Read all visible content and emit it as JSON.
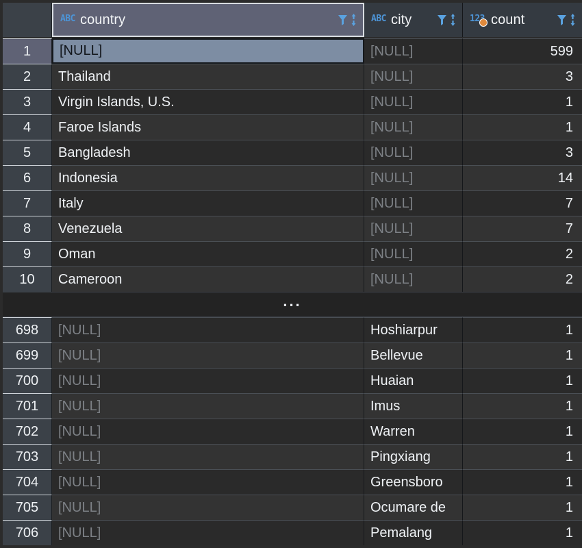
{
  "grid": {
    "columns": [
      {
        "key": "country",
        "label": "country",
        "type_icon": "abc-type-icon",
        "type": "text",
        "active": true
      },
      {
        "key": "city",
        "label": "city",
        "type_icon": "abc-type-icon",
        "type": "text",
        "active": false
      },
      {
        "key": "count",
        "label": "count",
        "type_icon": "123-type-icon",
        "type": "number",
        "active": false
      }
    ],
    "header_icons": {
      "filter": "filter-icon",
      "sort": "sort-ascending-descending-icon"
    },
    "null_text": "[NULL]",
    "ellipsis": "...",
    "selected_cell": {
      "row": "1",
      "column": "country"
    },
    "colors": {
      "header_bg": "#343a41",
      "header_active_bg": "#5f6275",
      "row_num_bg": "#3b4148",
      "row_odd_bg": "#2a2a2a",
      "row_even_bg": "#333333",
      "selection_bg": "#7d8da3",
      "text": "#eef1f4",
      "null_text": "#7d8186",
      "type_icon_blue": "#4d94d6",
      "number_badge_orange": "#e08a3c"
    },
    "rows_top": [
      {
        "num": "1",
        "country": "[NULL]",
        "country_null": false,
        "city": "[NULL]",
        "city_null": true,
        "count": "599"
      },
      {
        "num": "2",
        "country": "Thailand",
        "country_null": false,
        "city": "[NULL]",
        "city_null": true,
        "count": "3"
      },
      {
        "num": "3",
        "country": "Virgin Islands, U.S.",
        "country_null": false,
        "city": "[NULL]",
        "city_null": true,
        "count": "1"
      },
      {
        "num": "4",
        "country": "Faroe Islands",
        "country_null": false,
        "city": "[NULL]",
        "city_null": true,
        "count": "1"
      },
      {
        "num": "5",
        "country": "Bangladesh",
        "country_null": false,
        "city": "[NULL]",
        "city_null": true,
        "count": "3"
      },
      {
        "num": "6",
        "country": "Indonesia",
        "country_null": false,
        "city": "[NULL]",
        "city_null": true,
        "count": "14"
      },
      {
        "num": "7",
        "country": "Italy",
        "country_null": false,
        "city": "[NULL]",
        "city_null": true,
        "count": "7"
      },
      {
        "num": "8",
        "country": "Venezuela",
        "country_null": false,
        "city": "[NULL]",
        "city_null": true,
        "count": "7"
      },
      {
        "num": "9",
        "country": "Oman",
        "country_null": false,
        "city": "[NULL]",
        "city_null": true,
        "count": "2"
      },
      {
        "num": "10",
        "country": "Cameroon",
        "country_null": false,
        "city": "[NULL]",
        "city_null": true,
        "count": "2"
      }
    ],
    "rows_bottom": [
      {
        "num": "698",
        "country": "[NULL]",
        "country_null": true,
        "city": "Hoshiarpur",
        "city_null": false,
        "count": "1"
      },
      {
        "num": "699",
        "country": "[NULL]",
        "country_null": true,
        "city": "Bellevue",
        "city_null": false,
        "count": "1"
      },
      {
        "num": "700",
        "country": "[NULL]",
        "country_null": true,
        "city": "Huaian",
        "city_null": false,
        "count": "1"
      },
      {
        "num": "701",
        "country": "[NULL]",
        "country_null": true,
        "city": "Imus",
        "city_null": false,
        "count": "1"
      },
      {
        "num": "702",
        "country": "[NULL]",
        "country_null": true,
        "city": "Warren",
        "city_null": false,
        "count": "1"
      },
      {
        "num": "703",
        "country": "[NULL]",
        "country_null": true,
        "city": "Pingxiang",
        "city_null": false,
        "count": "1"
      },
      {
        "num": "704",
        "country": "[NULL]",
        "country_null": true,
        "city": "Greensboro",
        "city_null": false,
        "count": "1"
      },
      {
        "num": "705",
        "country": "[NULL]",
        "country_null": true,
        "city": "Ocumare de",
        "city_null": false,
        "count": "1"
      },
      {
        "num": "706",
        "country": "[NULL]",
        "country_null": true,
        "city": "Pemalang",
        "city_null": false,
        "count": "1"
      }
    ]
  }
}
